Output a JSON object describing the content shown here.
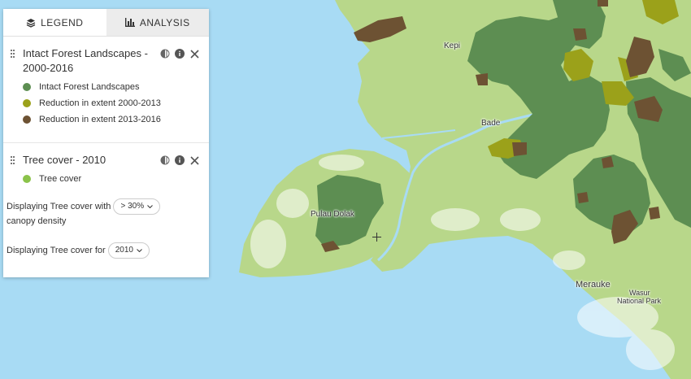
{
  "colors": {
    "water": "#a8dbf4",
    "land": "#b8d78a",
    "intact_forest": "#5d8e52",
    "reduction_2000_2013": "#9ba11a",
    "reduction_2013_2016": "#6d5233",
    "tree_cover": "#8bc34a"
  },
  "tabs": [
    {
      "label": "LEGEND",
      "icon": "layers-icon",
      "active": true
    },
    {
      "label": "ANALYSIS",
      "icon": "bar-chart-icon",
      "active": false
    }
  ],
  "layers": [
    {
      "title": "Intact Forest Landscapes - 2000-2016",
      "items": [
        {
          "label": "Intact Forest Landscapes",
          "color": "#5d8e52"
        },
        {
          "label": "Reduction in extent 2000-2013",
          "color": "#9ba11a"
        },
        {
          "label": "Reduction in extent 2013-2016",
          "color": "#6d5233"
        }
      ]
    },
    {
      "title": "Tree cover - 2010",
      "items": [
        {
          "label": "Tree cover",
          "color": "#8bc34a"
        }
      ],
      "density_text_before": "Displaying Tree cover with",
      "density_value": "> 30%",
      "density_text_after": "canopy density",
      "year_text": "Displaying Tree cover for",
      "year_value": "2010"
    }
  ],
  "map_labels": {
    "kepi": "Kepi",
    "bade": "Bade",
    "pulau_dolak": "Pulau Dolak",
    "merauke": "Merauke",
    "wasur_1": "Wasur",
    "wasur_2": "National Park"
  }
}
